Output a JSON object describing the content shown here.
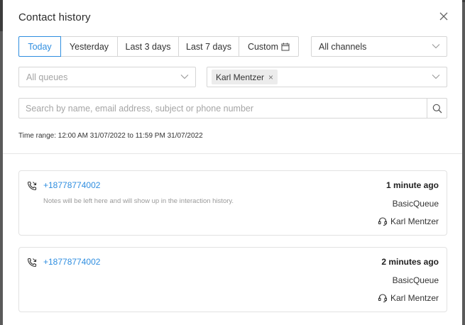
{
  "dialog": {
    "title": "Contact history",
    "close_icon": "close-icon"
  },
  "date_filter": {
    "options": [
      {
        "label": "Today",
        "active": true
      },
      {
        "label": "Yesterday",
        "active": false
      },
      {
        "label": "Last 3 days",
        "active": false
      },
      {
        "label": "Last 7 days",
        "active": false
      },
      {
        "label": "Custom",
        "active": false,
        "icon": "calendar-icon"
      }
    ]
  },
  "channels_select": {
    "value": "All channels"
  },
  "queues_select": {
    "placeholder": "All queues"
  },
  "agents_select": {
    "chips": [
      {
        "label": "Karl Mentzer",
        "remove_glyph": "×"
      }
    ]
  },
  "search": {
    "placeholder": "Search by name, email address, subject or phone number",
    "value": ""
  },
  "time_range": "Time range: 12:00 AM 31/07/2022 to 11:59 PM 31/07/2022",
  "contacts": [
    {
      "number": "+18778774002",
      "note": "Notes will be left here and will show up in the interaction history.",
      "time": "1 minute ago",
      "queue": "BasicQueue",
      "agent": "Karl Mentzer"
    },
    {
      "number": "+18778774002",
      "note": "",
      "time": "2 minutes ago",
      "queue": "BasicQueue",
      "agent": "Karl Mentzer"
    }
  ],
  "colors": {
    "accent": "#2f8ee0",
    "border": "#d6d6d6",
    "placeholder": "#a5a5a5"
  }
}
